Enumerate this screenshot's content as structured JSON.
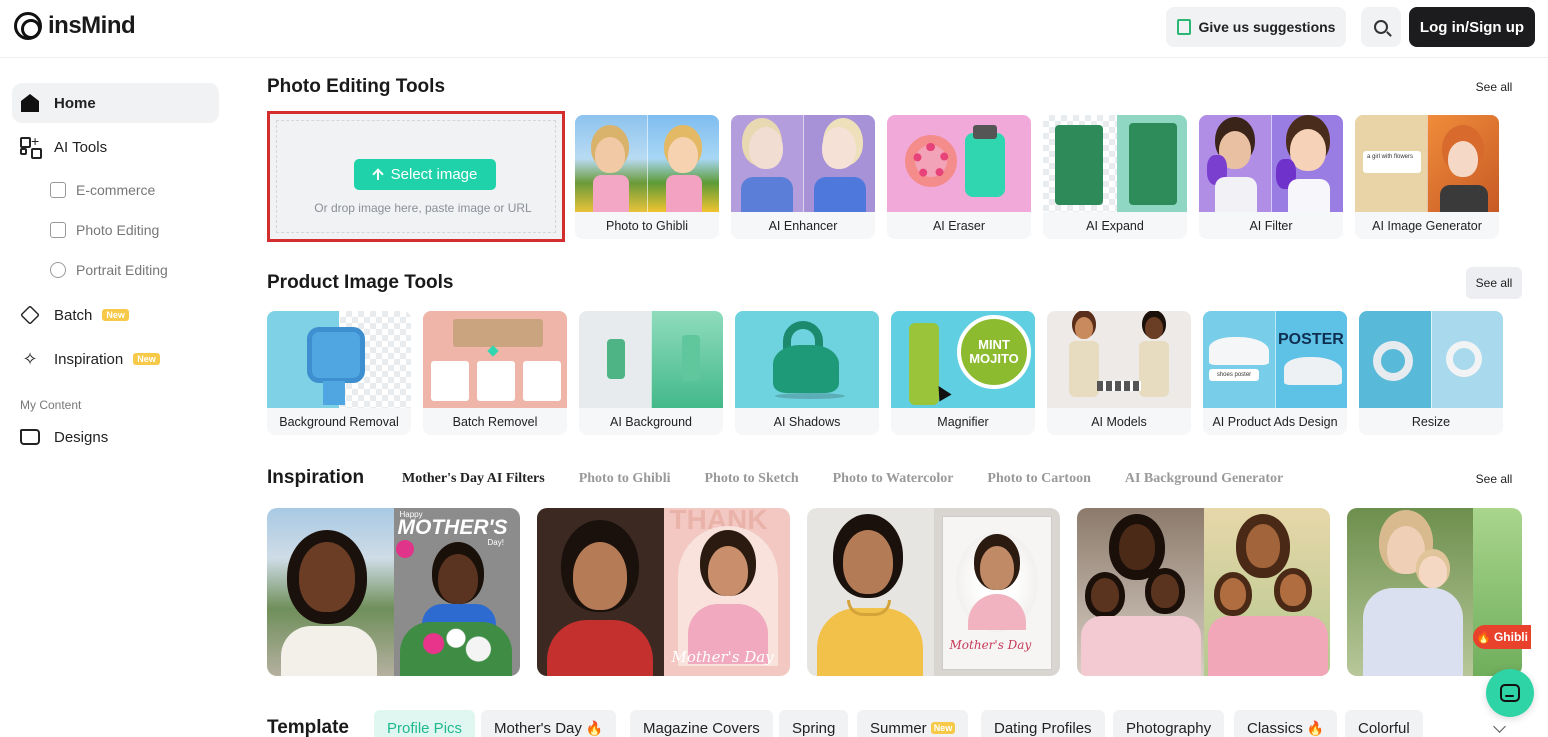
{
  "header": {
    "brand": "insMind",
    "suggest_label": "Give us suggestions",
    "login_label": "Log in/Sign up"
  },
  "sidebar": {
    "items": [
      {
        "label": "Home",
        "icon": "home-icon"
      },
      {
        "label": "AI Tools",
        "icon": "grid-icon"
      },
      {
        "label": "E-commerce",
        "icon": "bag-icon"
      },
      {
        "label": "Photo Editing",
        "icon": "image-icon"
      },
      {
        "label": "Portrait Editing",
        "icon": "portrait-icon"
      },
      {
        "label": "Batch",
        "icon": "layers-icon",
        "badge": "New"
      },
      {
        "label": "Inspiration",
        "icon": "sparkle-icon",
        "badge": "New"
      },
      {
        "label": "Designs",
        "icon": "folder-icon"
      }
    ],
    "section_label": "My Content"
  },
  "photo_editing": {
    "title": "Photo Editing Tools",
    "see_all": "See all",
    "upload": {
      "button_label": "Select image",
      "hint": "Or drop image here, paste image or URL"
    },
    "tools": [
      {
        "label": "Photo to Ghibli"
      },
      {
        "label": "AI Enhancer"
      },
      {
        "label": "AI Eraser"
      },
      {
        "label": "AI Expand"
      },
      {
        "label": "AI Filter"
      },
      {
        "label": "AI Image Generator",
        "overlay": "a girl with flowers"
      }
    ]
  },
  "product_image": {
    "title": "Product Image Tools",
    "see_all": "See all",
    "tools": [
      {
        "label": "Background Removal"
      },
      {
        "label": "Batch Removel"
      },
      {
        "label": "AI Background"
      },
      {
        "label": "AI Shadows"
      },
      {
        "label": "Magnifier",
        "overlay": "MINT MOJITO"
      },
      {
        "label": "AI Models"
      },
      {
        "label": "AI Product Ads Design",
        "overlay": "POSTER",
        "tag": "shoes poster"
      },
      {
        "label": "Resize"
      }
    ]
  },
  "inspiration": {
    "title": "Inspiration",
    "see_all": "See all",
    "tabs": [
      "Mother's Day AI Filters",
      "Photo to Ghibli",
      "Photo to Sketch",
      "Photo to Watercolor",
      "Photo to Cartoon",
      "AI Background Generator"
    ],
    "card_texts": {
      "magazine_small": "Happy",
      "magazine_big": "MOTHER'S",
      "magazine_day": "Day!",
      "thank": "THANK",
      "script": "Mother's Day"
    },
    "badge": "Ghibli"
  },
  "template": {
    "title": "Template",
    "tabs": [
      {
        "label": "Profile Pics",
        "active": true
      },
      {
        "label": "Mother's Day",
        "flame": true
      },
      {
        "label": "Magazine Covers"
      },
      {
        "label": "Spring"
      },
      {
        "label": "Summer",
        "badge": "New"
      },
      {
        "label": "Dating Profiles"
      },
      {
        "label": "Photography"
      },
      {
        "label": "Classics",
        "flame": true
      },
      {
        "label": "Colorful"
      }
    ]
  },
  "colors": {
    "accent": "#20d2a9",
    "highlight_border": "#d42d2d",
    "badge": "#f7c948"
  }
}
